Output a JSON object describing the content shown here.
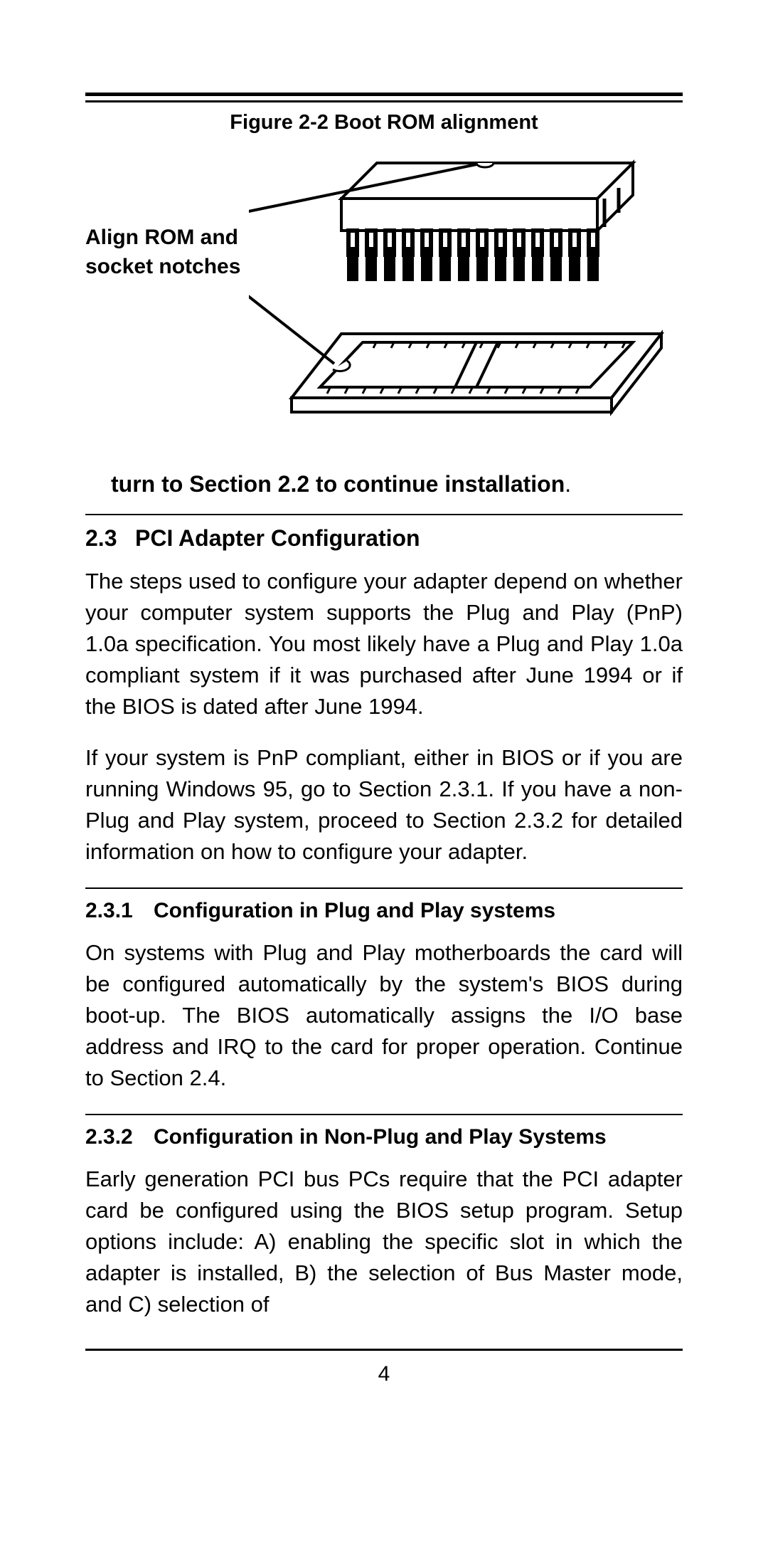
{
  "figure": {
    "caption": "Figure 2-2 Boot ROM alignment",
    "annotation": "Align ROM and socket notches"
  },
  "instruction": "turn to Section 2.2 to continue installation",
  "section_23": {
    "num": "2.3",
    "title": "PCI Adapter Configuration",
    "para1": "The steps used to configure your adapter depend on whether your computer system supports the Plug and Play (PnP) 1.0a specification. You most likely have a Plug and Play 1.0a compliant system if it was purchased after June 1994 or if the BIOS is dated after June 1994.",
    "para2": "If your system is PnP compliant, either in BIOS or if you are running Windows 95, go to Section 2.3.1. If you have a non-Plug and Play system, proceed to Section 2.3.2 for detailed information on how to configure your adapter."
  },
  "section_231": {
    "num": "2.3.1",
    "title": "Configuration in Plug and Play systems",
    "para": "On systems with Plug and Play motherboards the card will be configured automatically by the system's BIOS during boot-up. The BIOS automatically assigns the I/O base address and IRQ to the card for proper operation. Continue to Section 2.4."
  },
  "section_232": {
    "num": "2.3.2",
    "title": "Configuration in Non-Plug and Play Systems",
    "para": "Early generation PCI bus PCs require that the PCI adapter card be configured using the BIOS setup program. Setup options include: A) enabling the specific slot in which the adapter is installed, B) the selection of Bus Master mode, and C) selection of"
  },
  "page_number": "4"
}
